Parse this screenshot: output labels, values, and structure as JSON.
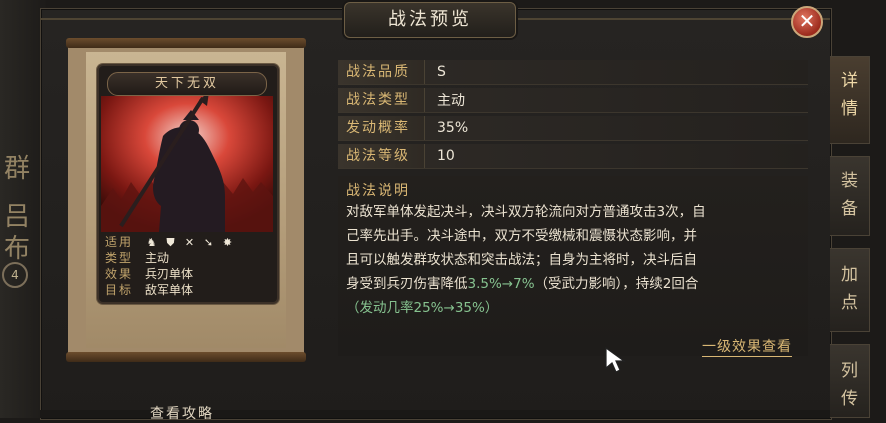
{
  "background": {
    "chars": [
      "群",
      "吕",
      "布"
    ],
    "badge": "4"
  },
  "dialog": {
    "title": "战法预览",
    "close_icon": "close-icon"
  },
  "skill_card": {
    "name": "天下无双",
    "info": [
      {
        "key": "适用",
        "value": ""
      },
      {
        "key": "类型",
        "value": "主动"
      },
      {
        "key": "效果",
        "value": "兵刃单体"
      },
      {
        "key": "目标",
        "value": "敌军单体"
      }
    ],
    "troop_icons": [
      "cavalry-icon",
      "shield-icon",
      "crossbow-icon",
      "spear-icon",
      "siege-icon"
    ]
  },
  "details": [
    {
      "label": "战法品质",
      "value": "S"
    },
    {
      "label": "战法类型",
      "value": "主动"
    },
    {
      "label": "发动概率",
      "value": "35%"
    },
    {
      "label": "战法等级",
      "value": "10"
    }
  ],
  "description": {
    "title": "战法说明",
    "line1": "对敌军单体发起决斗，决斗双方轮流向对方普通攻击3次，自",
    "line2": "己率先出手。决斗途中，双方不受缴械和震慑状态影响，并",
    "line3": "且可以触发群攻状态和突击战法；自身为主将时，决斗后自",
    "line4_a": "身受到兵刃伤害降低",
    "line4_green": "3.5%→7%",
    "line4_b": "（受武力影响），持续2回合",
    "line5_green": "（发动几率25%→35%）"
  },
  "effect_link": "一级效果查看",
  "side_tabs": [
    "详情",
    "装备",
    "加点",
    "列传"
  ],
  "bottom_button": "查看攻略",
  "colors": {
    "gold": "#d9b774",
    "green": "#86c28f",
    "close_red": "#9c2b1d"
  }
}
